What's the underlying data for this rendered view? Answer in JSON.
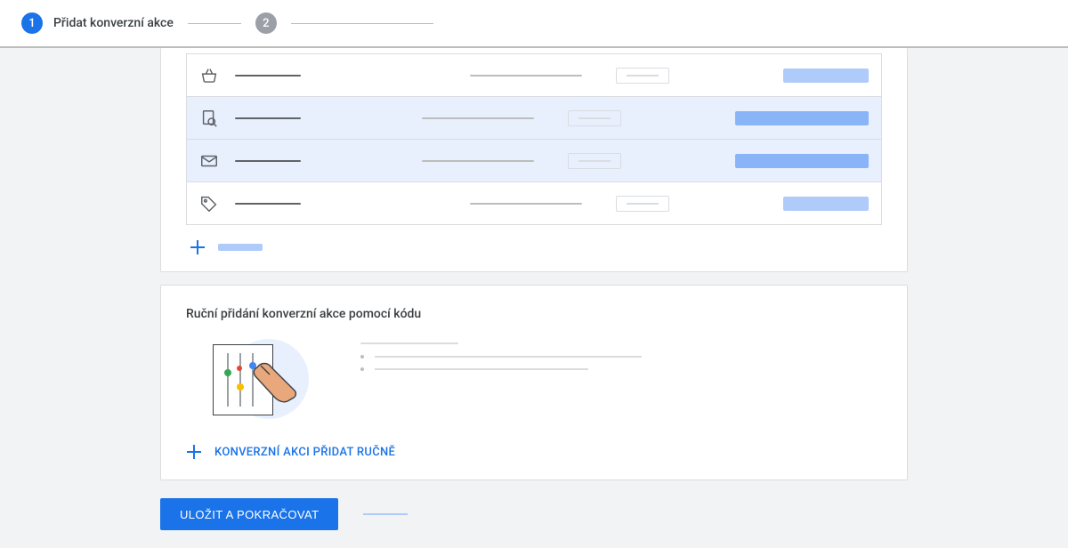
{
  "stepper": {
    "step1": {
      "num": "1",
      "label": "Přidat konverzní akce"
    },
    "step2": {
      "num": "2"
    }
  },
  "conversion_rows": [
    {
      "icon": "basket",
      "selected": false
    },
    {
      "icon": "search-doc",
      "selected": true
    },
    {
      "icon": "envelope",
      "selected": true
    },
    {
      "icon": "tag",
      "selected": false
    }
  ],
  "manual_card": {
    "title": "Ruční přidání konverzní akce pomocí kódu",
    "add_label": "KONVERZNÍ AKCI PŘIDAT RUČNĚ"
  },
  "footer": {
    "primary": "ULOŽIT A POKRAČOVAT"
  }
}
